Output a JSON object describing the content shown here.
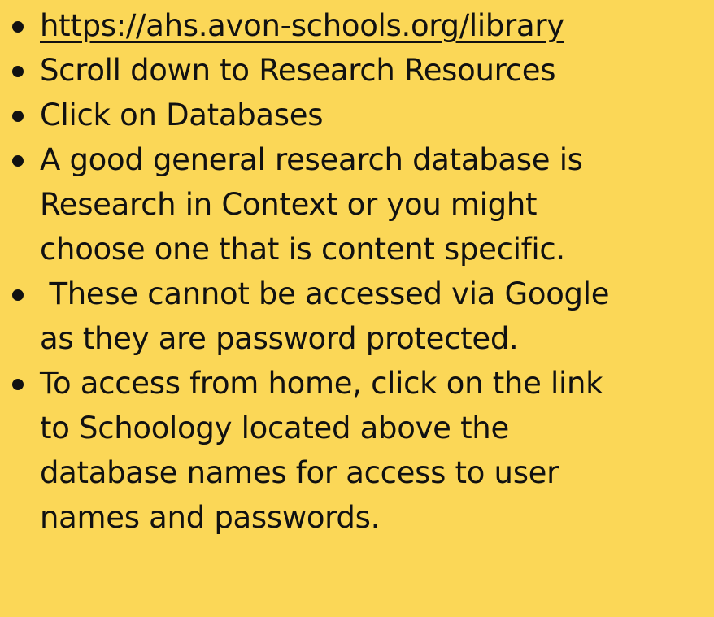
{
  "colors": {
    "background": "#FBD757",
    "text": "#111111"
  },
  "bullets": [
    {
      "lines": [
        "https://ahs.avon-schools.org/library"
      ],
      "is_link": true
    },
    {
      "lines": [
        "Scroll down to Research Resources"
      ]
    },
    {
      "lines": [
        "Click on Databases"
      ]
    },
    {
      "lines": [
        "A good general research database is",
        "Research in Context or you might",
        "choose one that is content specific."
      ]
    },
    {
      "lines": [
        " These cannot be accessed via Google",
        "as they are password protected."
      ]
    },
    {
      "lines": [
        "To access from home, click on the link",
        "to Schoology located above the",
        "database names for access to user",
        "names and passwords."
      ]
    }
  ]
}
